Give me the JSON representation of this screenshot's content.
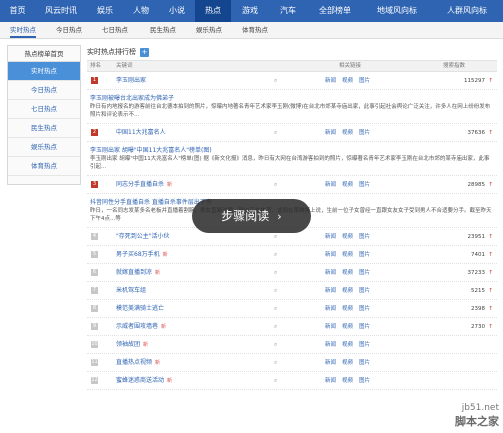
{
  "topnav": {
    "items": [
      "首页",
      "风云时讯",
      "娱乐",
      "人物",
      "小说",
      "热点",
      "游戏",
      "汽车",
      "全部榜单",
      "地域风向标",
      "人群风向标"
    ],
    "active_index": 5
  },
  "subnav": {
    "items": [
      "实时热点",
      "今日热点",
      "七日热点",
      "民生热点",
      "娱乐热点",
      "体育热点"
    ],
    "active_index": 0
  },
  "sidebar": {
    "title": "热点榜单首页",
    "items": [
      "实时热点",
      "今日热点",
      "七日热点",
      "民生热点",
      "娱乐热点",
      "体育热点"
    ],
    "active_index": 0
  },
  "main": {
    "title": "实时热点排行榜",
    "plus_icon": "+",
    "headers": {
      "rank": "排名",
      "keyword": "关键词",
      "related": "相关链接",
      "index": "搜索指数"
    },
    "link_labels": [
      "新闻",
      "视频",
      "图片"
    ],
    "search_glyph": "⌕",
    "up_glyph": "↑",
    "rows": [
      {
        "rank": "1",
        "keyword": "李玉刚出家",
        "hot": "",
        "index": "115297",
        "top": true
      },
      {
        "rank": "2",
        "keyword": "中国11大兆富名人",
        "hot": "",
        "index": "37636",
        "top": true
      },
      {
        "rank": "3",
        "keyword": "同志分手直播自杀",
        "hot": "新",
        "index": "28985",
        "top": true
      },
      {
        "rank": "4",
        "keyword": "\"存死到公主\"活小伙",
        "hot": "",
        "index": "23951",
        "top": false
      },
      {
        "rank": "5",
        "keyword": "男子买68万手机",
        "hot": "新",
        "index": "7401",
        "top": false
      },
      {
        "rank": "6",
        "keyword": "就嫁直播到凉",
        "hot": "新",
        "index": "37233",
        "top": false
      },
      {
        "rank": "7",
        "keyword": "米机驾车组",
        "hot": "",
        "index": "5215",
        "top": false
      },
      {
        "rank": "8",
        "keyword": "模范美满骑士逃亡",
        "hot": "",
        "index": "2398",
        "top": false
      },
      {
        "rank": "9",
        "keyword": "示威者围攻墙巷",
        "hot": "新",
        "index": "2730",
        "top": false
      },
      {
        "rank": "10",
        "keyword": "领袖故团",
        "hot": "新",
        "index": "",
        "top": false
      },
      {
        "rank": "11",
        "keyword": "直播热点视频",
        "hot": "新",
        "index": "",
        "top": false
      },
      {
        "rank": "12",
        "keyword": "蜜蜂迷惑商送活动",
        "hot": "新",
        "index": "",
        "top": false
      }
    ],
    "descs": [
      {
        "title": "李玉刚被曝台北出家成为佛弟子",
        "text": "昨日有内地报名的游客前往台北德本拍到的照片，惊曝内地著名青年艺术家李玉刚(微博)在台北市郊某寺庙出家，此事引起社会舆论广泛关注，许多人在网上纷纷发布照片和评论表示不..."
      },
      {
        "title": "李玉刚出家 胡曝\"中国11大兆富名人\"榜单(图)",
        "text": "李玉刚出家 胡曝\"中国11大兆富名人\"榜单(图) 据《新文化报》消息，昨日有大网在台湾游客拍到的照片，惊曝著名青年艺术家李玉刚在台北市郊的某寺庙出家，此事引起..."
      },
      {
        "title": "抖音同性分手直播自杀 直播自杀事件层出不穷",
        "text": "昨日，一名同志发某多名老板并直播着割腕，男女直面对质，疑似正在热恋，这同在某微博上说，生前一位子女曾经一直跟女友女子受到男人不合适要分手。截至昨天下午4点...等"
      }
    ]
  },
  "overlay": {
    "label": "步骤阅读",
    "chevron": "›"
  },
  "watermark": {
    "site": "jb51.net",
    "brand": "脚本之家"
  }
}
